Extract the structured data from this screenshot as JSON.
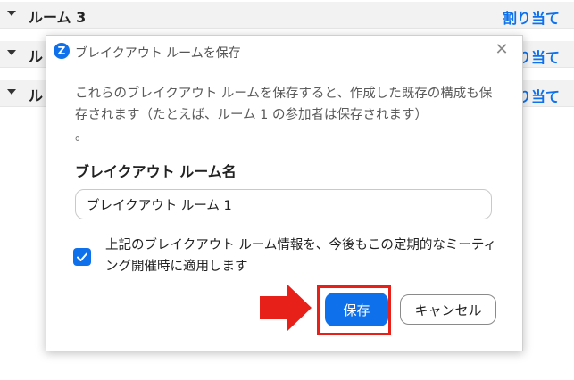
{
  "background": {
    "rows": [
      {
        "name": "ルーム 3",
        "action": "割り当て"
      },
      {
        "name": "ル",
        "action": "り当て"
      },
      {
        "name": "ル",
        "action": "り当て"
      }
    ]
  },
  "dialog": {
    "title": "ブレイクアウト ルームを保存",
    "app_icon_glyph": "Z",
    "close_glyph": "✕",
    "description": "これらのブレイクアウト ルームを保存すると、作成した既存の構成も保存されます（たとえば、ルーム 1 の参加者は保存されます）",
    "description_tail": "。",
    "field_label": "ブレイクアウト ルーム名",
    "field_value": "ブレイクアウト ルーム 1",
    "checkbox_checked": true,
    "checkbox_label": "上記のブレイクアウト ルーム情報を、今後もこの定期的なミーティング開催時に適用します",
    "save_label": "保存",
    "cancel_label": "キャンセル"
  },
  "colors": {
    "accent": "#0e71eb",
    "highlight": "#e8201a"
  }
}
